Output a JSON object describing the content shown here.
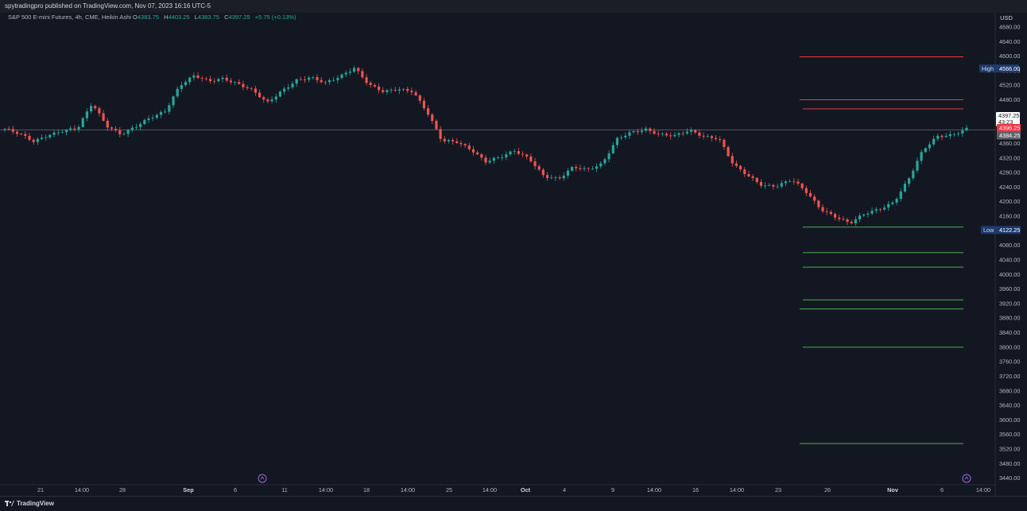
{
  "header": {
    "publisher": "spytradingpro published on TradingView.com, Nov 07, 2023 16:16 UTC-5"
  },
  "legend": {
    "symbol": "S&P 500 E-mini Futures, 4h, CME, Heikin Ashi",
    "open_label": "O",
    "open": "4383.75",
    "high_label": "H",
    "high": "4403.25",
    "low_label": "L",
    "low": "4383.75",
    "close_label": "C",
    "close": "4397.25",
    "change": "+5.75 (+0.13%)"
  },
  "axis": {
    "currency": "USD"
  },
  "footer": {
    "brand": "TradingView"
  },
  "colors": {
    "background": "#131722",
    "up": "#26a69a",
    "down": "#ef5350",
    "support": "#4caf50",
    "resistance": "#f23645",
    "label_blue": "#1e3a6e"
  },
  "chart_data": {
    "type": "candlestick",
    "title": "S&P 500 E-mini Futures, 4h, CME, Heikin Ashi",
    "ylim": [
      3420,
      4700
    ],
    "y_ticks": [
      3440,
      3480,
      3520,
      3560,
      3600,
      3640,
      3680,
      3720,
      3760,
      3800,
      3840,
      3880,
      3920,
      3960,
      4000,
      4040,
      4080,
      4120,
      4160,
      4200,
      4240,
      4280,
      4320,
      4360,
      4400,
      4440,
      4480,
      4520,
      4560,
      4600,
      4640,
      4680
    ],
    "x_ticks": [
      {
        "label": "21",
        "major": false
      },
      {
        "label": "14:00",
        "major": false
      },
      {
        "label": "28",
        "major": false
      },
      {
        "label": "Sep",
        "major": true
      },
      {
        "label": "6",
        "major": false
      },
      {
        "label": "11",
        "major": false
      },
      {
        "label": "14:00",
        "major": false
      },
      {
        "label": "18",
        "major": false
      },
      {
        "label": "14:00",
        "major": false
      },
      {
        "label": "25",
        "major": false
      },
      {
        "label": "14:00",
        "major": false
      },
      {
        "label": "Oct",
        "major": true
      },
      {
        "label": "4",
        "major": false
      },
      {
        "label": "9",
        "major": false
      },
      {
        "label": "14:00",
        "major": false
      },
      {
        "label": "16",
        "major": false
      },
      {
        "label": "14:00",
        "major": false
      },
      {
        "label": "23",
        "major": false
      },
      {
        "label": "26",
        "major": false
      },
      {
        "label": "Nov",
        "major": true
      },
      {
        "label": "6",
        "major": false
      },
      {
        "label": "14:00",
        "major": false
      }
    ],
    "path_keypoints": [
      4400,
      4385,
      4365,
      4385,
      4395,
      4400,
      4470,
      4410,
      4385,
      4405,
      4430,
      4450,
      4520,
      4545,
      4530,
      4540,
      4525,
      4505,
      4470,
      4505,
      4535,
      4540,
      4525,
      4545,
      4570,
      4520,
      4500,
      4510,
      4505,
      4445,
      4365,
      4365,
      4345,
      4310,
      4320,
      4340,
      4320,
      4270,
      4260,
      4295,
      4290,
      4305,
      4370,
      4390,
      4400,
      4385,
      4380,
      4395,
      4380,
      4375,
      4300,
      4270,
      4245,
      4245,
      4260,
      4225,
      4180,
      4160,
      4140,
      4165,
      4180,
      4200,
      4260,
      4340,
      4380,
      4385,
      4400
    ],
    "series": [
      {
        "name": "S&P 500 E-mini Futures",
        "candles": 235
      }
    ],
    "levels": {
      "resistance": [
        4598,
        4480,
        4455
      ],
      "support": [
        4130,
        4060,
        4020,
        3930,
        3905,
        3800,
        3535
      ]
    },
    "price_labels": {
      "high": {
        "label": "High",
        "value": "4566.00"
      },
      "low": {
        "label": "Low",
        "value": "4122.25"
      },
      "last": {
        "value": "4397.25",
        "countdown": "43:23"
      },
      "prev": {
        "value": "4396.25"
      },
      "ref": {
        "value": "4384.25"
      }
    }
  }
}
